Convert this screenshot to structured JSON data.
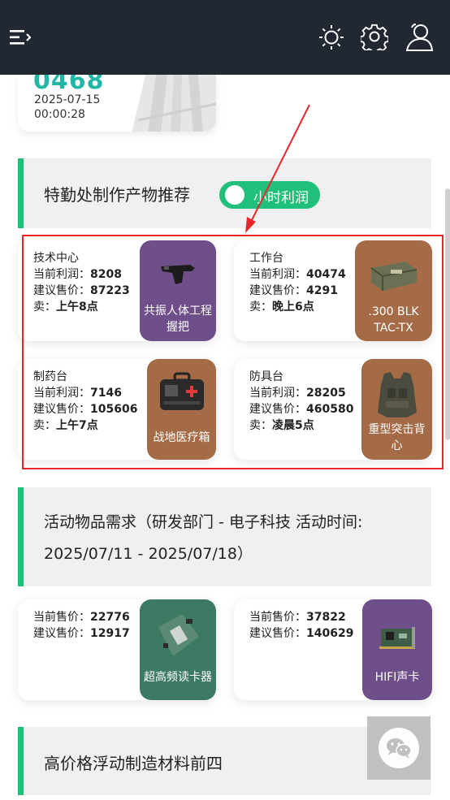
{
  "header": {
    "menu_icon": "menu-icon",
    "theme_icon": "sun-icon",
    "settings_icon": "gear-icon",
    "user_icon": "user-icon"
  },
  "time_card": {
    "code": "0468",
    "date": "2025-07-15",
    "time": "00:00:28"
  },
  "crafting": {
    "title": "特勤处制作产物推荐",
    "toggle_label": "小时利润",
    "profit_label": "当前利润：",
    "price_label": "建议售价：",
    "sell_label": "卖：",
    "items": [
      {
        "station": "技术中心",
        "profit": "8208",
        "price": "87223",
        "sell": "上午8点",
        "name": "共振人体工程握把"
      },
      {
        "station": "工作台",
        "profit": "40474",
        "price": "4291",
        "sell": "晚上6点",
        "name": ".300 BLK TAC-TX"
      },
      {
        "station": "制药台",
        "profit": "7146",
        "price": "105606",
        "sell": "上午7点",
        "name": "战地医疗箱"
      },
      {
        "station": "防具台",
        "profit": "28205",
        "price": "460580",
        "sell": "凌晨5点",
        "name": "重型突击背心"
      }
    ]
  },
  "activity": {
    "title_line1": "活动物品需求（研发部门 - 电子科技 活动时间:",
    "title_line2": "2025/07/11 - 2025/07/18）",
    "current_label": "当前售价：",
    "price_label": "建议售价：",
    "items": [
      {
        "current": "22776",
        "price": "12917",
        "name": "超高频读卡器"
      },
      {
        "current": "37822",
        "price": "140629",
        "name": "HIFI声卡"
      }
    ]
  },
  "materials": {
    "title": "高价格浮动制造材料前四"
  },
  "floating": {
    "wechat_icon": "wechat-icon"
  },
  "colors": {
    "topbar": "#222831",
    "accent_green": "#21c07a",
    "code_teal": "#20b8a4",
    "highlight_red": "#e5272d",
    "thumb_purple": "#6f4f8a",
    "thumb_brown": "#a46b46",
    "thumb_teal": "#3c7a64"
  }
}
